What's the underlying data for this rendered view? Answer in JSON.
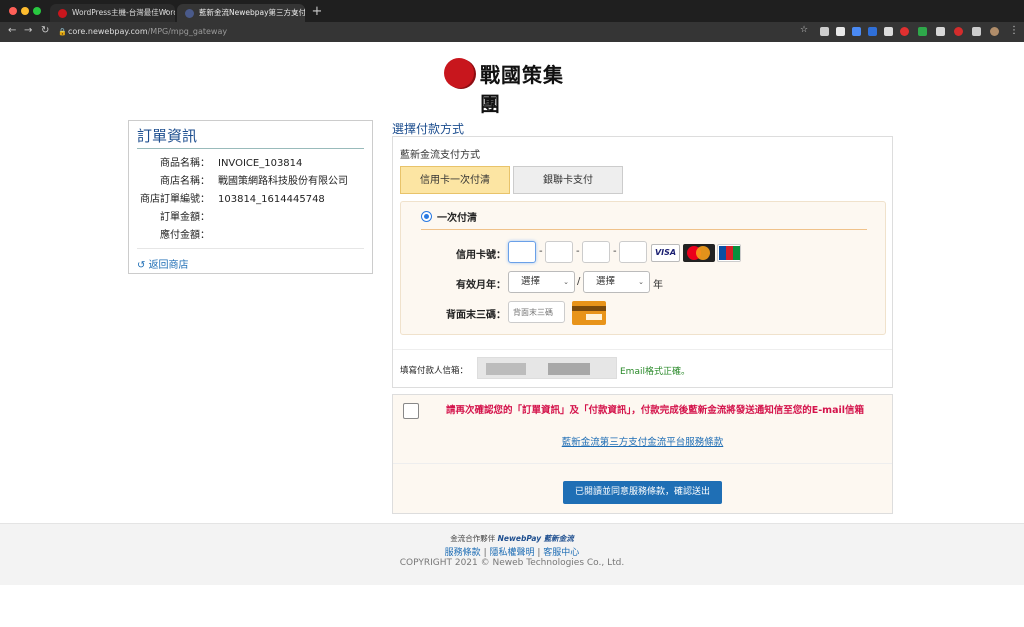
{
  "browser": {
    "tabs": [
      {
        "title": "WordPress主機-台灣最佳WordP",
        "active": false
      },
      {
        "title": "藍新金流Newebpay第三方支付金",
        "active": true
      }
    ],
    "url_host": "core.newebpay.com",
    "url_path": "/MPG/mpg_gateway"
  },
  "logo": {
    "text": "戰國策集團"
  },
  "order": {
    "title": "訂單資訊",
    "rows": [
      {
        "key": "商品名稱：",
        "value": "INVOICE_103814"
      },
      {
        "key": "商店名稱：",
        "value": "戰國策網路科技股份有限公司"
      },
      {
        "key": "商店訂單編號：",
        "value": "103814_1614445748"
      },
      {
        "key": "訂單金額：",
        "value": ""
      },
      {
        "key": "應付金額：",
        "value": ""
      }
    ],
    "back_label": "返回商店"
  },
  "payment": {
    "title": "選擇付款方式",
    "method_label": "藍新金流支付方式",
    "tabs": [
      {
        "label": "信用卡一次付清",
        "active": true
      },
      {
        "label": "銀聯卡支付",
        "active": false
      }
    ],
    "option_label": "一次付清",
    "card_number_label": "信用卡號：",
    "expiry_label": "有效月年：",
    "month_select": "選擇",
    "year_select": "選擇",
    "year_suffix": "年",
    "cvv_label": "背面末三碼：",
    "cvv_placeholder": "背面末三碼",
    "brands": [
      "VISA",
      "MasterCard",
      "JCB"
    ],
    "email_label": "填寫付款人信箱：",
    "email_status": "Email格式正確。"
  },
  "confirm": {
    "warning": "請再次確認您的「訂單資訊」及「付款資訊」，付款完成後藍新金流將發送通知信至您的E-mail信箱",
    "terms_link": "藍新金流第三方支付金流平台服務條款",
    "submit_label": "已閱讀並同意服務條款，確認送出"
  },
  "footer": {
    "partner_label": "金流合作夥伴",
    "partner_brand": "NewebPay 藍新金流",
    "links": [
      "服務條款",
      "隱私權聲明",
      "客服中心"
    ],
    "copyright": "COPYRIGHT 2021 © Neweb Technologies Co., Ltd."
  },
  "colors": {
    "primary": "#1d4e8f",
    "link": "#1d6db5",
    "warning": "#d4134b",
    "submit": "#1f6fb5",
    "logo": "#c8161d"
  }
}
